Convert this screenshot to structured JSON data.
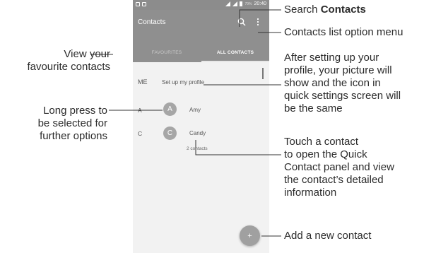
{
  "status_bar": {
    "time": "20:40",
    "battery": "79%"
  },
  "app_bar": {
    "title": "Contacts"
  },
  "tabs": [
    {
      "label": "FAVOURITES"
    },
    {
      "label": "ALL CONTACTS"
    }
  ],
  "me_row": {
    "label": "ME",
    "text": "Set up my profile"
  },
  "contacts": [
    {
      "letter": "A",
      "initial": "A",
      "name": "Amy"
    },
    {
      "letter": "C",
      "initial": "C",
      "name": "Candy"
    }
  ],
  "contacts_count": "2 contacts",
  "fab_icon": "+",
  "callouts": {
    "search_prefix": "Search ",
    "search_bold": "Contacts",
    "options_menu": "Contacts list option menu",
    "favourites_line1": "View your",
    "favourites_line2": "favourite contacts",
    "profile_lines": [
      "After setting up your",
      "profile, your picture will",
      "show and the icon in",
      "quick settings screen will",
      "be the same"
    ],
    "long_press_lines": [
      "Long press to",
      "be selected for",
      "further options"
    ],
    "touch_lines": [
      "Touch a contact",
      "to open the Quick",
      "Contact panel and view",
      "the contact’s detailed",
      "information"
    ],
    "add_contact": "Add a new contact"
  }
}
